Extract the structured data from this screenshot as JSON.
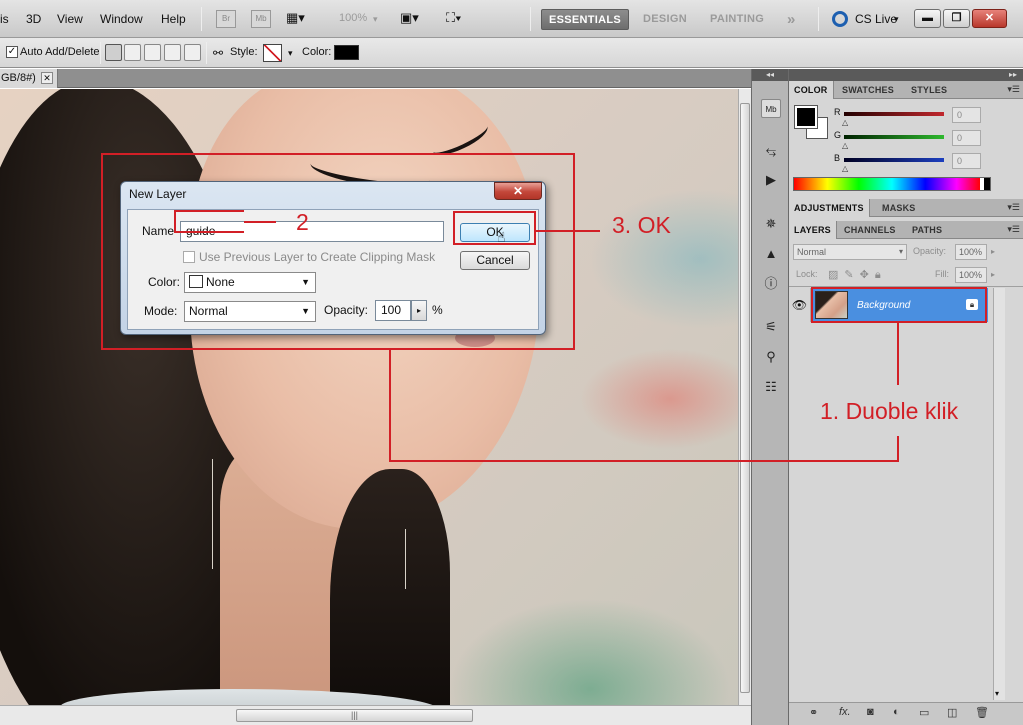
{
  "menubar": {
    "items": [
      "is",
      "3D",
      "View",
      "Window",
      "Help"
    ],
    "zoom": "100%",
    "workspaces": [
      "ESSENTIALS",
      "DESIGN",
      "PAINTING"
    ],
    "more": "»",
    "cslive": "CS Live"
  },
  "options": {
    "auto_add_delete": "Auto Add/Delete",
    "style_label": "Style:",
    "color_label": "Color:"
  },
  "document": {
    "tab_label": "GB/8#)"
  },
  "dialog": {
    "title": "New Layer",
    "name_label": "Name",
    "name_value": "guide",
    "clip_label": "Use Previous Layer to Create Clipping Mask",
    "color_label": "Color:",
    "color_value": "None",
    "mode_label": "Mode:",
    "mode_value": "Normal",
    "opacity_label": "Opacity:",
    "opacity_value": "100",
    "percent": "%",
    "ok_label": "OK",
    "cancel_label": "Cancel",
    "close_glyph": "✕"
  },
  "panels": {
    "color_tabs": [
      "COLOR",
      "SWATCHES",
      "STYLES"
    ],
    "sliders": [
      {
        "label": "R",
        "value": "0",
        "color": "#c1272d"
      },
      {
        "label": "G",
        "value": "0",
        "color": "#2eb82e"
      },
      {
        "label": "B",
        "value": "0",
        "color": "#1d3fbf"
      }
    ],
    "adj_tabs": [
      "ADJUSTMENTS",
      "MASKS"
    ],
    "layer_tabs": [
      "LAYERS",
      "CHANNELS",
      "PATHS"
    ],
    "blend_mode": "Normal",
    "opacity_label": "Opacity:",
    "opacity_value": "100%",
    "lock_label": "Lock:",
    "fill_label": "Fill:",
    "fill_value": "100%",
    "layer_name": "Background"
  },
  "annotations": {
    "step1": "1. Duoble klik",
    "step2": "2",
    "step3": "3. OK"
  },
  "colors": {
    "annotation_red": "#d21f26",
    "selected_layer": "#4a8fe0"
  }
}
